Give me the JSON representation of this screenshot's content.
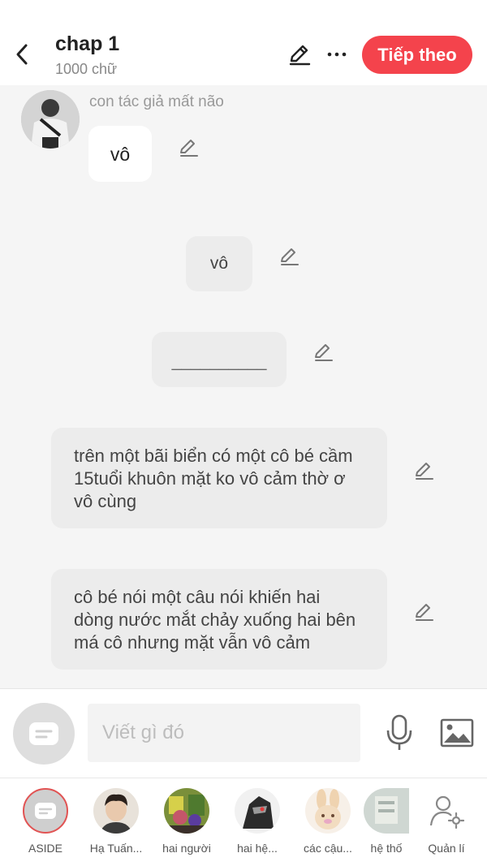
{
  "header": {
    "title": "chap 1",
    "word_count": "1000 chữ",
    "next_label": "Tiếp theo"
  },
  "chat": {
    "sender_name": "con tác giả mất não",
    "messages": [
      {
        "text": "vô"
      },
      {
        "text": "vô"
      },
      {
        "text": "__________"
      },
      {
        "text": "trên một bãi biển có một cô bé cầm 15tuổi khuôn mặt ko vô cảm thờ ơ vô cùng"
      },
      {
        "text": "cô bé nói một câu nói khiến hai dòng nước mắt chảy xuống hai bên má cô nhưng mặt vẫn vô cảm"
      }
    ]
  },
  "composer": {
    "placeholder": "Viết gì đó"
  },
  "characters": [
    {
      "label": "ASIDE"
    },
    {
      "label": "Hạ Tuấn..."
    },
    {
      "label": "hai người"
    },
    {
      "label": "hai hệ..."
    },
    {
      "label": "các cậu..."
    },
    {
      "label": "hệ thố"
    },
    {
      "label": "Quản lí"
    }
  ],
  "colors": {
    "accent": "#f4434c",
    "background": "#f5f5f5",
    "bubble_grey": "#ececec"
  }
}
